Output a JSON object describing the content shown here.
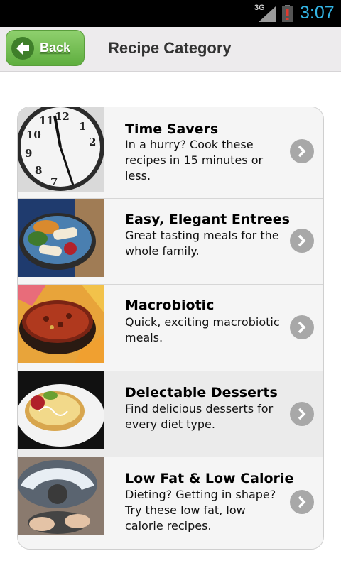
{
  "status_bar": {
    "network": "3G",
    "time": "3:07",
    "icons": [
      "signal-icon",
      "battery-alert-icon"
    ]
  },
  "header": {
    "back_label": "Back",
    "title": "Recipe Category"
  },
  "categories": [
    {
      "title": "Time Savers",
      "description": "In a hurry? Cook these recipes in 15 minutes or less.",
      "image": "clock-image"
    },
    {
      "title": "Easy, Elegant Entrees",
      "description": "Great tasting meals for the whole family.",
      "image": "entree-plate-image"
    },
    {
      "title": "Macrobiotic",
      "description": "Quick, exciting macrobiotic meals.",
      "image": "chili-bowl-image"
    },
    {
      "title": "Delectable Desserts",
      "description": "Find delicious desserts for every diet type.",
      "image": "tart-dessert-image"
    },
    {
      "title": "Low Fat & Low Calorie",
      "description": "Dieting? Getting in shape? Try these low fat, low calorie recipes.",
      "image": "scale-image"
    }
  ],
  "colors": {
    "back_button": "#6cbf4b",
    "clock": "#33b5e5",
    "chevron": "#a8a8a8"
  }
}
